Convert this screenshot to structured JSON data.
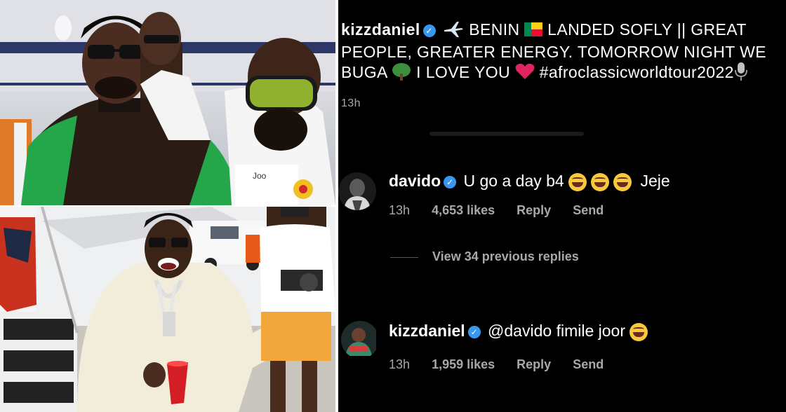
{
  "post": {
    "username": "kizzdaniel",
    "caption_part1": "BENIN",
    "caption_part2": "LANDED SOFLY || GREAT PEOPLE, GREATER ENERGY. TOMORROW NIGHT WE BUGA",
    "caption_part3": "I LOVE YOU",
    "hashtag": "#afroclassicworldtour2022",
    "time": "13h"
  },
  "comments": [
    {
      "username": "davido",
      "text_prefix": "U go a day b4",
      "text_suffix": "Jeje",
      "time": "13h",
      "likes": "4,653 likes",
      "reply_label": "Reply",
      "send_label": "Send"
    },
    {
      "username": "kizzdaniel",
      "mention": "@davido",
      "text": "fimile joor",
      "time": "13h",
      "likes": "1,959 likes",
      "reply_label": "Reply",
      "send_label": "Send"
    }
  ],
  "view_replies": "View 34 previous replies",
  "icons": {
    "verified": "verified-badge-icon",
    "plane": "airplane-emoji",
    "flag": "benin-flag-emoji",
    "tree": "tree-emoji",
    "heart": "red-heart-emoji",
    "mic": "microphone-emoji",
    "laugh": "tears-of-joy-emoji"
  },
  "colors": {
    "background": "#000000",
    "verified": "#3897f0",
    "muted": "#a8a8a8",
    "heart": "#e0245e"
  }
}
